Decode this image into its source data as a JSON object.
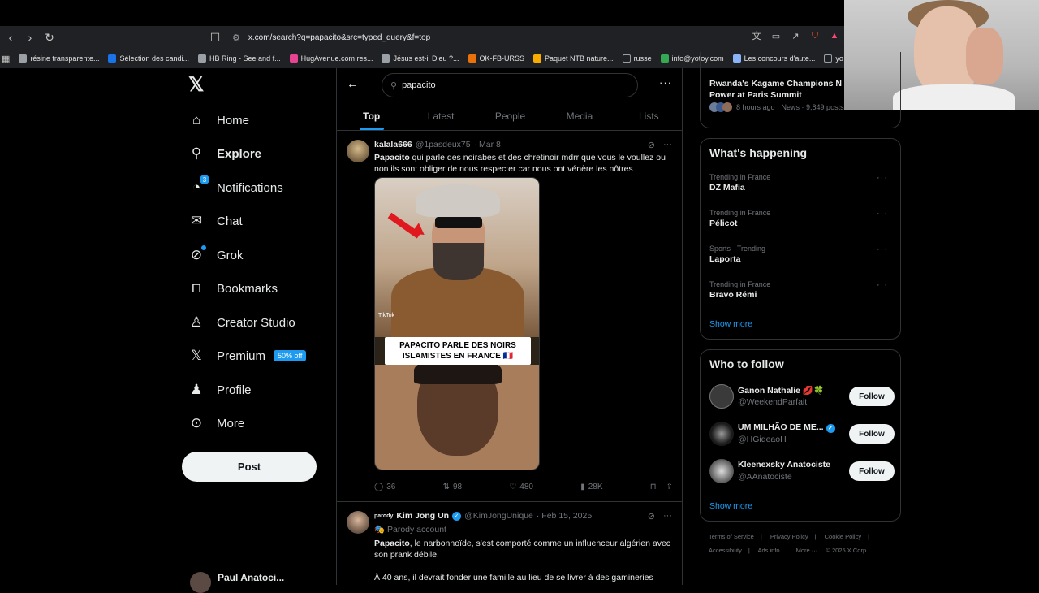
{
  "browser": {
    "url": "x.com/search?q=papacito&src=typed_query&f=top",
    "bookmarks": [
      {
        "label": "résine transparente...",
        "color": "#9aa0a6"
      },
      {
        "label": "Sélection des candi...",
        "color": "#1a73e8"
      },
      {
        "label": "HB Ring - See and f...",
        "color": "#9aa0a6"
      },
      {
        "label": "HugAvenue.com res...",
        "color": "#e84393"
      },
      {
        "label": "Jésus est-il Dieu ?...",
        "color": "#9aa0a6"
      },
      {
        "label": "OK-FB-URSS",
        "color": "#e8710a"
      },
      {
        "label": "Paquet NTB nature...",
        "color": "#f9ab00"
      },
      {
        "label": "russe",
        "color": "#9aa0a6"
      },
      {
        "label": "info@yotoy.com",
        "color": "#34a853"
      },
      {
        "label": "Les concours d'aute...",
        "color": "#8ab4f8"
      },
      {
        "label": "yo",
        "color": "#9aa0a6"
      }
    ]
  },
  "nav": {
    "items": [
      {
        "label": "Home",
        "icon": "home-icon",
        "glyph": "⌂"
      },
      {
        "label": "Explore",
        "icon": "search-icon",
        "glyph": "⚲"
      },
      {
        "label": "Notifications",
        "icon": "bell-icon",
        "glyph": "🔔"
      },
      {
        "label": "Chat",
        "icon": "mail-icon",
        "glyph": "✉"
      },
      {
        "label": "Grok",
        "icon": "grok-icon",
        "glyph": "⊘"
      },
      {
        "label": "Bookmarks",
        "icon": "bookmark-icon",
        "glyph": "🔖"
      },
      {
        "label": "Creator Studio",
        "icon": "creator-icon",
        "glyph": "♙"
      },
      {
        "label": "Premium",
        "icon": "x-logo-icon",
        "glyph": "𝕏"
      },
      {
        "label": "Profile",
        "icon": "person-icon",
        "glyph": "👤"
      },
      {
        "label": "More",
        "icon": "more-circle-icon",
        "glyph": "⊙"
      }
    ],
    "notifications_count": "3",
    "premium_badge": "50% off",
    "post_button": "Post",
    "account_name": "Paul Anatoci..."
  },
  "search": {
    "query": "papacito",
    "tabs": [
      "Top",
      "Latest",
      "People",
      "Media",
      "Lists"
    ],
    "active_tab": "Top"
  },
  "tweets": [
    {
      "name": "kalala666",
      "handle": "@1pasdeux75",
      "date": "· Mar 8",
      "text_bold": "Papacito",
      "text": " qui parle des noirabes et des chretinoir mdrr que vous le voullez ou non ils sont obliger de nous respecter car nous ont vénère les nôtres",
      "media_caption": "PAPACITO PARLE DES NOIRS ISLAMISTES EN FRANCE 🇫🇷",
      "media_watermark": "TikTok",
      "replies": "36",
      "reposts": "98",
      "likes": "480",
      "views": "28K"
    },
    {
      "parody_tag": "parody",
      "name": "Kim Jong Un",
      "handle": "@KimJongUnique",
      "date": "· Feb 15, 2025",
      "label": "Parody account",
      "text_bold": "Papacito",
      "text": ", le narbonnoïde, s'est comporté comme un influenceur algérien avec son prank débile.",
      "text2": "À 40 ans, il devrait fonder une famille au lieu de se livrer à des gamineries"
    }
  ],
  "right": {
    "news_title": "Rwanda's Kagame Champions N Power at Paris Summit",
    "news_meta": "8 hours ago · News · 9,849 posts",
    "whats_happening": "What's happening",
    "trends": [
      {
        "context": "Trending in France",
        "title": "DZ Mafia"
      },
      {
        "context": "Trending in France",
        "title": "Pélicot"
      },
      {
        "context": "Sports · Trending",
        "title": "Laporta"
      },
      {
        "context": "Trending in France",
        "title": "Bravo Rémi"
      }
    ],
    "show_more": "Show more",
    "who_to_follow": "Who to follow",
    "suggestions": [
      {
        "name": "Ganon Nathalie 💋🍀",
        "handle": "@WeekendParfait",
        "follow": "Follow",
        "color": "#3a3a3a"
      },
      {
        "name": "UM MILHÃO DE ME...",
        "handle": "@HGideaoH",
        "follow": "Follow",
        "color": "#1b1b1b",
        "verified": "✓"
      },
      {
        "name": "Kleenexsky Anatociste",
        "handle": "@AAnatociste",
        "follow": "Follow",
        "color": "#555555"
      }
    ],
    "show_more2": "Show more",
    "footer": [
      "Terms of Service",
      "|",
      "Privacy Policy",
      "|",
      "Cookie Policy",
      "|",
      "Accessibility",
      "|",
      "Ads info",
      "|",
      "More ···",
      "© 2025 X Corp."
    ]
  }
}
